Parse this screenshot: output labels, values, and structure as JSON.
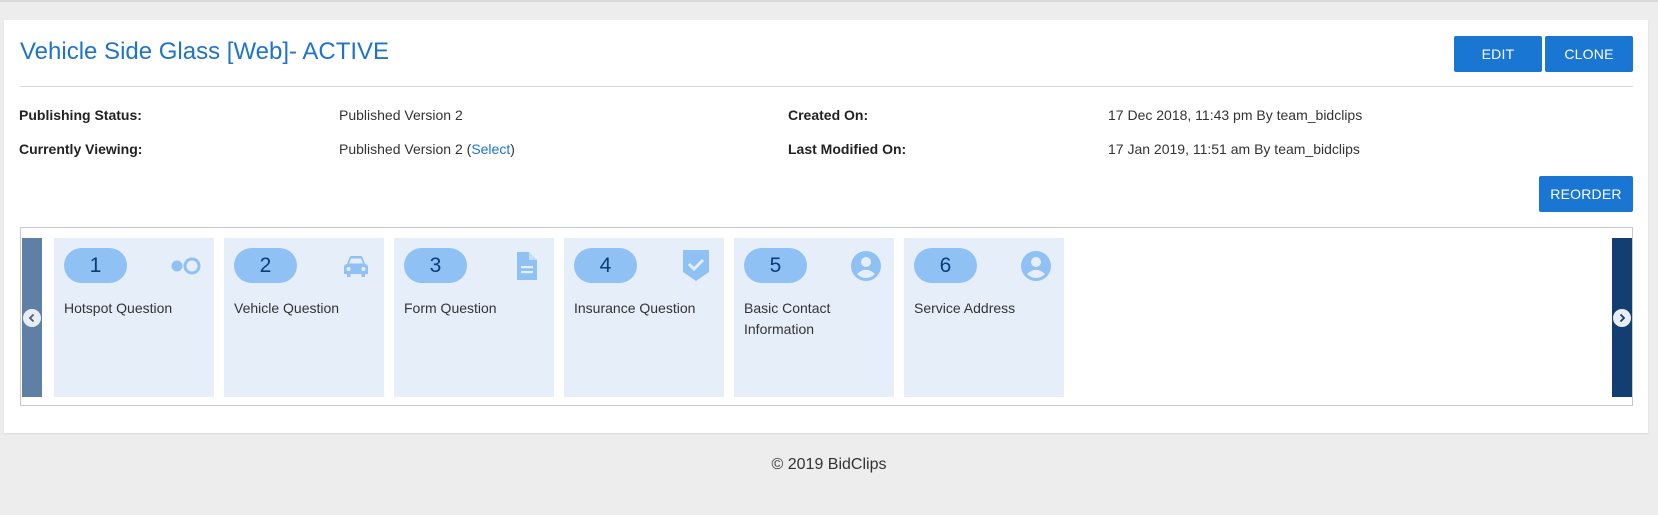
{
  "header": {
    "title": "Vehicle Side Glass [Web]- ACTIVE",
    "edit_label": "EDIT",
    "clone_label": "CLONE",
    "reorder_label": "REORDER"
  },
  "info": {
    "publishing_status_label": "Publishing Status:",
    "publishing_status_value": "Published Version 2",
    "currently_viewing_label": "Currently Viewing:",
    "currently_viewing_value": "Published Version 2 (",
    "currently_viewing_link": "Select",
    "currently_viewing_suffix": ")",
    "created_on_label": "Created On:",
    "created_on_value": "17 Dec 2018, 11:43 pm By team_bidclips",
    "last_modified_label": "Last Modified On:",
    "last_modified_value": "17 Jan 2019, 11:51 am By team_bidclips"
  },
  "steps": [
    {
      "number": "1",
      "label": "Hotspot Question",
      "icon": "hotspot-icon"
    },
    {
      "number": "2",
      "label": "Vehicle Question",
      "icon": "car-icon"
    },
    {
      "number": "3",
      "label": "Form Question",
      "icon": "document-icon"
    },
    {
      "number": "4",
      "label": "Insurance Question",
      "icon": "shield-check-icon"
    },
    {
      "number": "5",
      "label": "Basic Contact Information",
      "icon": "user-circle-icon"
    },
    {
      "number": "6",
      "label": "Service Address",
      "icon": "user-circle-icon"
    }
  ],
  "footer": {
    "copyright": "© 2019 BidClips"
  },
  "colors": {
    "accent": "#1976d2",
    "step_bg": "#e6eff9",
    "pill_bg": "#8fc1f4",
    "nav_left": "#5f7fa6",
    "nav_right": "#123e72"
  }
}
